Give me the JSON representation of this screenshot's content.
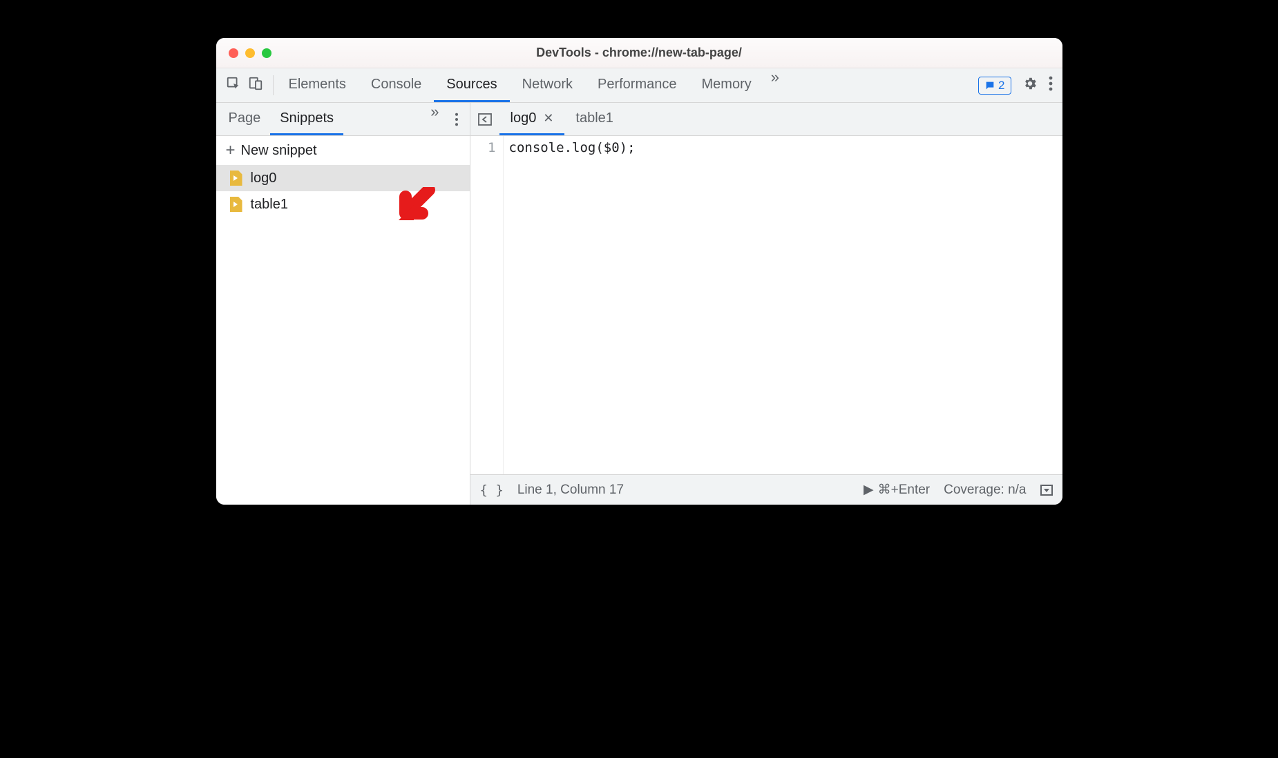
{
  "window": {
    "title": "DevTools - chrome://new-tab-page/"
  },
  "toolbar": {
    "tabs": [
      "Elements",
      "Console",
      "Sources",
      "Network",
      "Performance",
      "Memory"
    ],
    "active": "Sources",
    "more": "»",
    "badge_count": "2"
  },
  "left_panel": {
    "tabs": [
      "Page",
      "Snippets"
    ],
    "active": "Snippets",
    "more": "»",
    "new_snippet_label": "New snippet",
    "snippets": [
      {
        "name": "log0",
        "selected": true
      },
      {
        "name": "table1",
        "selected": false
      }
    ]
  },
  "editor": {
    "tabs": [
      {
        "name": "log0",
        "active": true,
        "closeable": true
      },
      {
        "name": "table1",
        "active": false,
        "closeable": false
      }
    ],
    "lines": [
      {
        "num": "1",
        "text": "console.log($0);"
      }
    ]
  },
  "statusbar": {
    "pretty": "{ }",
    "cursor": "Line 1, Column 17",
    "run_hint": "⌘+Enter",
    "coverage": "Coverage: n/a"
  }
}
